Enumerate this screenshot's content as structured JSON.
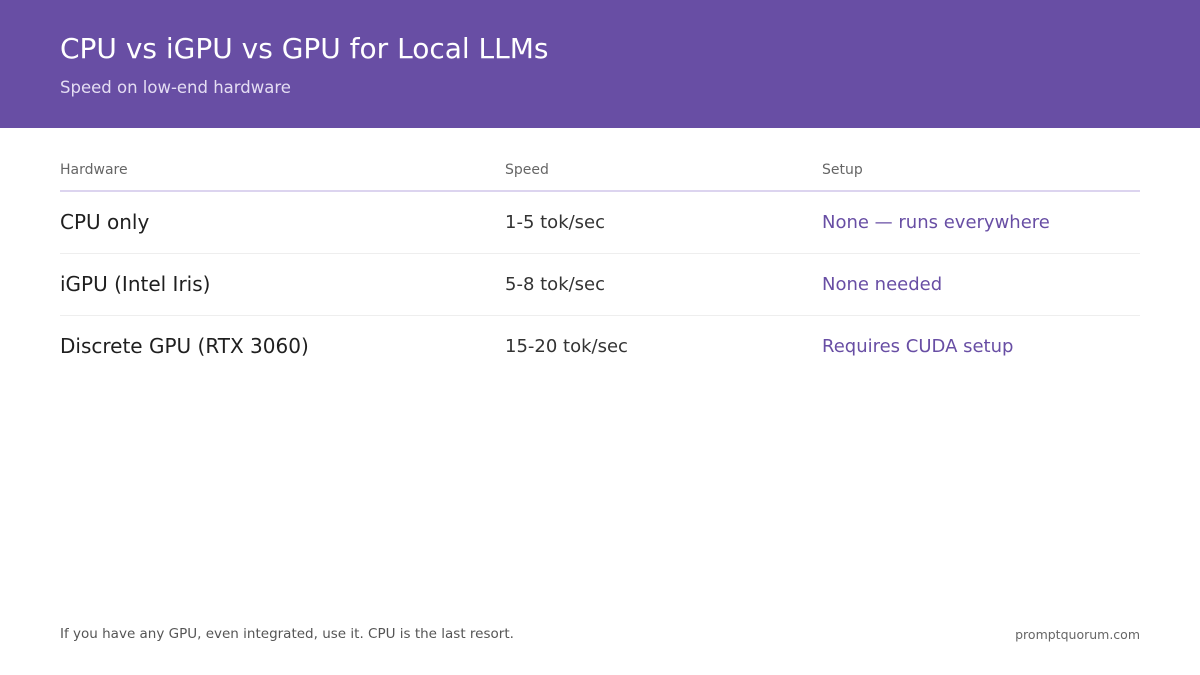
{
  "header": {
    "title": "CPU vs iGPU vs GPU for Local LLMs",
    "subtitle": "Speed on low-end hardware"
  },
  "table": {
    "columns": [
      "Hardware",
      "Speed",
      "Setup"
    ],
    "rows": [
      {
        "hardware": "CPU only",
        "speed": "1-5 tok/sec",
        "setup": "None — runs everywhere"
      },
      {
        "hardware": "iGPU (Intel Iris)",
        "speed": "5-8 tok/sec",
        "setup": "None needed"
      },
      {
        "hardware": "Discrete GPU (RTX 3060)",
        "speed": "15-20 tok/sec",
        "setup": "Requires CUDA setup"
      }
    ]
  },
  "footer": {
    "note": "If you have any GPU, even integrated, use it. CPU is the last resort.",
    "brand": "promptquorum.com"
  },
  "colors": {
    "accent": "#684ea4",
    "header_background": "#684ea4"
  }
}
